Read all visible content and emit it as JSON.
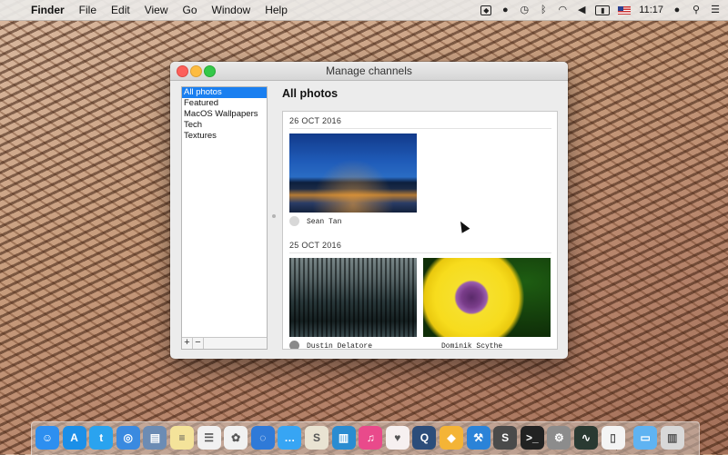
{
  "menubar": {
    "apple": "",
    "items": [
      "Finder",
      "File",
      "Edit",
      "View",
      "Go",
      "Window",
      "Help"
    ],
    "clock": "11:17",
    "status_icons": [
      "dropbox-icon",
      "record-icon",
      "time-machine-icon",
      "bluetooth-icon",
      "wifi-icon",
      "volume-icon",
      "battery-icon",
      "flag-us-icon",
      "user-icon",
      "spotlight-icon",
      "notification-center-icon"
    ]
  },
  "window": {
    "title": "Manage channels",
    "sidebar": {
      "items": [
        "All photos",
        "Featured",
        "MacOS Wallpapers",
        "Tech",
        "Textures"
      ],
      "selected_index": 0,
      "add_label": "+",
      "remove_label": "−"
    },
    "main": {
      "title": "All photos",
      "groups": [
        {
          "date": "26 OCT 2016",
          "photos": [
            {
              "author": "Sean Tan",
              "subject": "city-skyline-night"
            }
          ]
        },
        {
          "date": "25 OCT 2016",
          "photos": [
            {
              "author": "Dustin Delatore",
              "subject": "forest-lake"
            },
            {
              "author": "Dominik Scythe",
              "subject": "yellow-daisy"
            }
          ]
        }
      ]
    }
  },
  "dock": {
    "apps": [
      {
        "name": "finder-icon",
        "glyph": "☺",
        "color": "#2d8ff0"
      },
      {
        "name": "app-store-icon",
        "glyph": "A",
        "color": "#1b8fe8"
      },
      {
        "name": "twitter-icon",
        "glyph": "t",
        "color": "#2aa3ef"
      },
      {
        "name": "safari-icon",
        "glyph": "◎",
        "color": "#3a8ae0"
      },
      {
        "name": "preview-icon",
        "glyph": "▤",
        "color": "#6c8cb4"
      },
      {
        "name": "notes-icon",
        "glyph": "≡",
        "color": "#f4e39a"
      },
      {
        "name": "reminders-icon",
        "glyph": "☰",
        "color": "#f1f1f1"
      },
      {
        "name": "photos-icon",
        "glyph": "✿",
        "color": "#f1f1f1"
      },
      {
        "name": "signal-icon",
        "glyph": "◌",
        "color": "#2f7ad8"
      },
      {
        "name": "messages-icon",
        "glyph": "…",
        "color": "#37a5f4"
      },
      {
        "name": "slack-icon",
        "glyph": "S",
        "color": "#e9e3d2"
      },
      {
        "name": "trello-icon",
        "glyph": "▥",
        "color": "#2a8cd1"
      },
      {
        "name": "itunes-icon",
        "glyph": "♫",
        "color": "#e94a8b"
      },
      {
        "name": "health-icon",
        "glyph": "♥",
        "color": "#f6f0f0"
      },
      {
        "name": "quicktime-icon",
        "glyph": "Q",
        "color": "#2c4d7a"
      },
      {
        "name": "sketch-icon",
        "glyph": "◆",
        "color": "#f4b436"
      },
      {
        "name": "xcode-icon",
        "glyph": "⚒",
        "color": "#2b83d8"
      },
      {
        "name": "sublime-text-icon",
        "glyph": "S",
        "color": "#4a4a4a"
      },
      {
        "name": "terminal-icon",
        "glyph": ">_",
        "color": "#222222"
      },
      {
        "name": "system-preferences-icon",
        "glyph": "⚙",
        "color": "#8c8c8c"
      },
      {
        "name": "activity-monitor-icon",
        "glyph": "∿",
        "color": "#2a3a32"
      },
      {
        "name": "document-icon",
        "glyph": "▯",
        "color": "#f4f4f4"
      },
      {
        "name": "folder-icon",
        "glyph": "▭",
        "color": "#5fb3f2"
      },
      {
        "name": "trash-icon",
        "glyph": "▥",
        "color": "#d8d8d8"
      }
    ]
  }
}
